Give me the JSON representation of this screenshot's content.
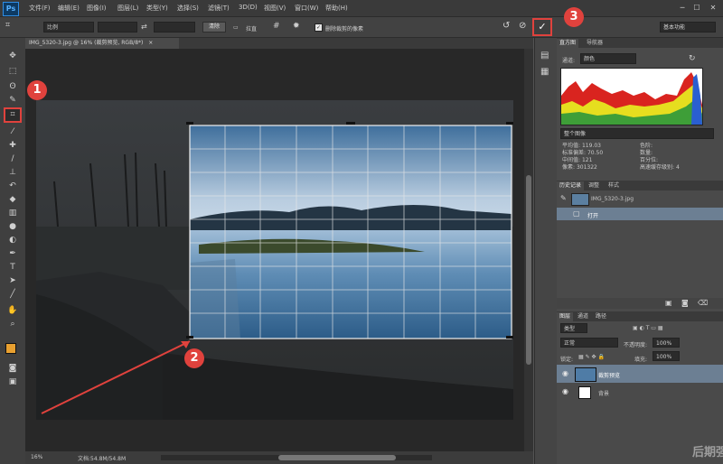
{
  "app": {
    "logo": "Ps"
  },
  "menu": [
    "文件(F)",
    "编辑(E)",
    "图像(I)",
    "图层(L)",
    "类型(Y)",
    "选择(S)",
    "滤镜(T)",
    "3D(D)",
    "视图(V)",
    "窗口(W)",
    "帮助(H)"
  ],
  "window_controls": {
    "minimize": "─",
    "maximize": "☐",
    "close": "✕"
  },
  "options": {
    "ratio_select": "比例",
    "swap_icon": "⇄",
    "clear_button": "清除",
    "straighten_label": "拉直",
    "delete_cropped_label": "删除裁剪的像素",
    "delete_cropped_checked": true,
    "workspace_select": "基本功能",
    "commit": "✓"
  },
  "document": {
    "tab_title": "IMG_5320-3.jpg @ 16% (裁剪预览, RGB/8*)",
    "tab_close": "×"
  },
  "status": {
    "zoom": "16%",
    "doc_info": "文档:54.8M/54.8M"
  },
  "histogram": {
    "tabs": [
      "直方图",
      "导航器"
    ],
    "channel_label": "通道:",
    "channel": "颜色",
    "source": "整个图像",
    "stats_left": [
      [
        "平均值:",
        "119.03"
      ],
      [
        "标准偏差:",
        "70.50"
      ],
      [
        "中间值:",
        "121"
      ],
      [
        "像素:",
        "301322"
      ]
    ],
    "stats_right": [
      [
        "色阶:",
        ""
      ],
      [
        "数量:",
        ""
      ],
      [
        "百分位:",
        ""
      ],
      [
        "高速缓存级别:",
        "4"
      ]
    ]
  },
  "history": {
    "tabs": [
      "历史记录",
      "调整",
      "样式"
    ],
    "snapshot": "IMG_5320-3.jpg",
    "steps": [
      "打开"
    ]
  },
  "layers": {
    "tabs": [
      "图层",
      "通道",
      "路径"
    ],
    "kind": "类型",
    "blend_mode": "正常",
    "opacity_label": "不透明度:",
    "opacity": "100%",
    "lock_label": "锁定:",
    "fill_label": "填充:",
    "fill": "100%",
    "rows": [
      {
        "name": "裁剪预览",
        "selected": true
      },
      {
        "name": "背景",
        "selected": false
      }
    ]
  },
  "annotations": [
    "1",
    "2",
    "3"
  ],
  "watermark": "后期强",
  "colors": {
    "accent_red": "#e0423d",
    "fg_swatch": "#e8a030",
    "bg_swatch": "#ffffff"
  }
}
